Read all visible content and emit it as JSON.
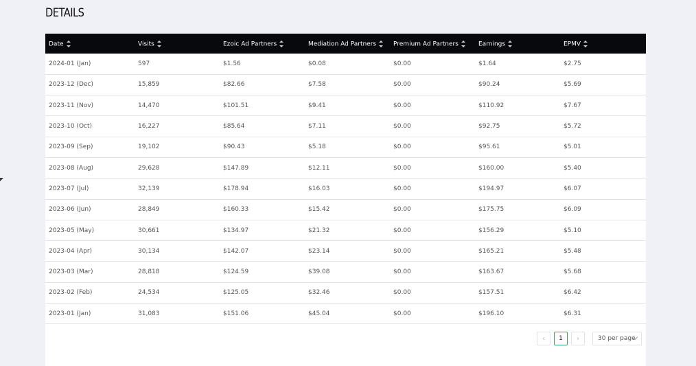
{
  "section": {
    "title": "DETAILS"
  },
  "table": {
    "columns": [
      "Date",
      "Visits",
      "Ezoic Ad Partners",
      "Mediation Ad Partners",
      "Premium Ad Partners",
      "Earnings",
      "EPMV"
    ],
    "rows": [
      [
        "2024-01 (Jan)",
        "597",
        "$1.56",
        "$0.08",
        "$0.00",
        "$1.64",
        "$2.75"
      ],
      [
        "2023-12 (Dec)",
        "15,859",
        "$82.66",
        "$7.58",
        "$0.00",
        "$90.24",
        "$5.69"
      ],
      [
        "2023-11 (Nov)",
        "14,470",
        "$101.51",
        "$9.41",
        "$0.00",
        "$110.92",
        "$7.67"
      ],
      [
        "2023-10 (Oct)",
        "16,227",
        "$85.64",
        "$7.11",
        "$0.00",
        "$92.75",
        "$5.72"
      ],
      [
        "2023-09 (Sep)",
        "19,102",
        "$90.43",
        "$5.18",
        "$0.00",
        "$95.61",
        "$5.01"
      ],
      [
        "2023-08 (Aug)",
        "29,628",
        "$147.89",
        "$12.11",
        "$0.00",
        "$160.00",
        "$5.40"
      ],
      [
        "2023-07 (Jul)",
        "32,139",
        "$178.94",
        "$16.03",
        "$0.00",
        "$194.97",
        "$6.07"
      ],
      [
        "2023-06 (Jun)",
        "28,849",
        "$160.33",
        "$15.42",
        "$0.00",
        "$175.75",
        "$6.09"
      ],
      [
        "2023-05 (May)",
        "30,661",
        "$134.97",
        "$21.32",
        "$0.00",
        "$156.29",
        "$5.10"
      ],
      [
        "2023-04 (Apr)",
        "30,134",
        "$142.07",
        "$23.14",
        "$0.00",
        "$165.21",
        "$5.48"
      ],
      [
        "2023-03 (Mar)",
        "28,818",
        "$124.59",
        "$39.08",
        "$0.00",
        "$163.67",
        "$5.68"
      ],
      [
        "2023-02 (Feb)",
        "24,534",
        "$125.05",
        "$32.46",
        "$0.00",
        "$157.51",
        "$6.42"
      ],
      [
        "2023-01 (Jan)",
        "31,083",
        "$151.06",
        "$45.04",
        "$0.00",
        "$196.10",
        "$6.31"
      ]
    ]
  },
  "pagination": {
    "prev_icon": "chevron-left-icon",
    "next_icon": "chevron-right-icon",
    "current_page": "1",
    "per_page": "30 per page"
  },
  "colors": {
    "header_bg": "#07090c",
    "active_page_border": "#3a9b57",
    "page_bg": "#f0f0f7"
  }
}
